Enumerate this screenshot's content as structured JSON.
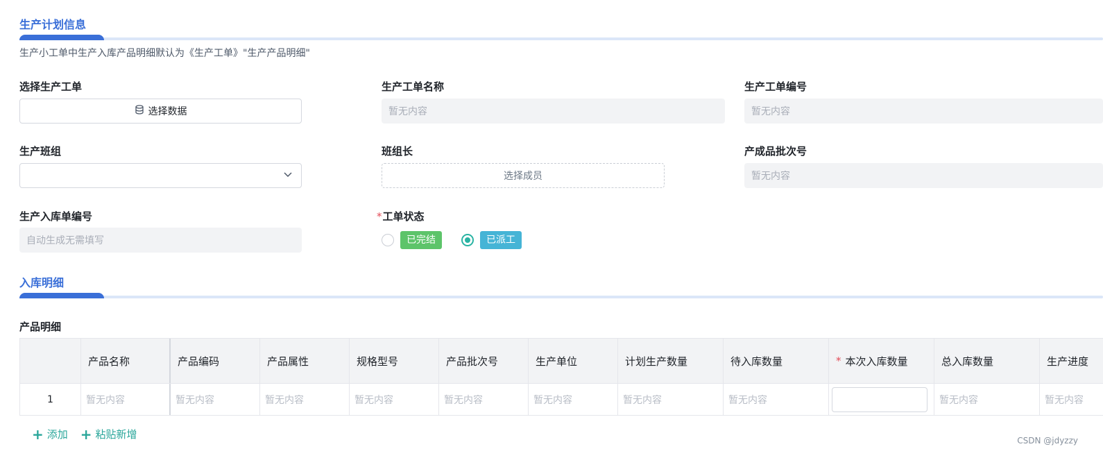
{
  "sections": {
    "plan_title": "生产计划信息",
    "detail_title": "入库明细"
  },
  "hint": "生产小工单中生产入库产品明细默认为《生产工单》\"生产产品明细\"",
  "fields": {
    "select_order_label": "选择生产工单",
    "select_order_button": "选择数据",
    "order_name_label": "生产工单名称",
    "order_name_value": "暂无内容",
    "order_number_label": "生产工单编号",
    "order_number_value": "暂无内容",
    "team_label": "生产班组",
    "team_value": "",
    "leader_label": "班组长",
    "leader_button": "选择成员",
    "batch_label": "产成品批次号",
    "batch_value": "暂无内容",
    "inbound_number_label": "生产入库单编号",
    "inbound_number_placeholder": "自动生成无需填写",
    "status_label": "工单状态",
    "status_required_mark": "*",
    "status_options": [
      {
        "label": "已完结",
        "checked": false,
        "color": "#5dc46a"
      },
      {
        "label": "已派工",
        "checked": true,
        "color": "#45b4d6"
      }
    ]
  },
  "table": {
    "title": "产品明细",
    "required_mark": "*",
    "columns": [
      "",
      "产品名称",
      "产品编码",
      "产品属性",
      "规格型号",
      "产品批次号",
      "生产单位",
      "计划生产数量",
      "待入库数量",
      "本次入库数量",
      "总入库数量",
      "生产进度"
    ],
    "rows": [
      [
        "1",
        "暂无内容",
        "暂无内容",
        "暂无内容",
        "暂无内容",
        "暂无内容",
        "暂无内容",
        "暂无内容",
        "暂无内容",
        "",
        "暂无内容",
        "暂无内容"
      ]
    ]
  },
  "actions": {
    "add_label": "添加",
    "paste_add_label": "粘贴新增"
  },
  "watermark": "CSDN @jdyzzy",
  "colors": {
    "accent": "#3a6fd8",
    "teal": "#29b3a3"
  }
}
